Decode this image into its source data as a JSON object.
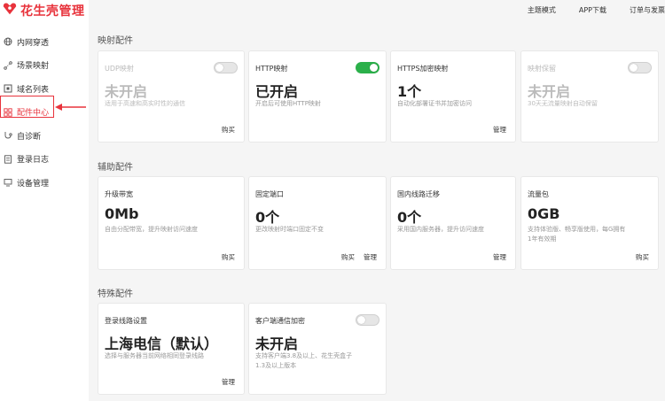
{
  "brand": {
    "name": "花生壳管理",
    "color": "#e8333c"
  },
  "topbar": {
    "links": [
      "主题模式",
      "APP下载",
      "订单与发票"
    ]
  },
  "sidebar": {
    "items": [
      {
        "label": "内网穿透",
        "icon": "globe-icon"
      },
      {
        "label": "场景映射",
        "icon": "route-icon"
      },
      {
        "label": "域名列表",
        "icon": "domain-icon"
      },
      {
        "label": "配件中心",
        "icon": "grid-icon",
        "active": true
      },
      {
        "label": "自诊断",
        "icon": "diagnose-icon"
      },
      {
        "label": "登录日志",
        "icon": "log-icon"
      },
      {
        "label": "设备管理",
        "icon": "device-icon"
      }
    ]
  },
  "sections": [
    {
      "title": "映射配件",
      "cards": [
        {
          "title": "UDP映射",
          "value": "未开启",
          "desc": "适用于高速和高实时性的通信",
          "toggle": "off",
          "disabled": true,
          "actions": [
            "购买"
          ]
        },
        {
          "title": "HTTP映射",
          "value": "已开启",
          "desc": "开启后可使用HTTP映射",
          "toggle": "on",
          "disabled": false,
          "actions": []
        },
        {
          "title": "HTTPS加密映射",
          "value": "1个",
          "desc": "自动化部署证书并加密访问",
          "toggle": null,
          "disabled": false,
          "actions": [
            "管理"
          ]
        },
        {
          "title": "映射保留",
          "value": "未开启",
          "desc": "30天无流量映射自动保留",
          "toggle": "off",
          "disabled": true,
          "actions": []
        }
      ]
    },
    {
      "title": "辅助配件",
      "cards": [
        {
          "title": "升级带宽",
          "value": "0Mb",
          "desc": "自由分配带宽，提升映射访问速度",
          "toggle": null,
          "disabled": false,
          "actions": [
            "购买"
          ]
        },
        {
          "title": "固定端口",
          "value": "0个",
          "desc": "更改映射时端口固定不变",
          "toggle": null,
          "disabled": false,
          "actions": [
            "购买",
            "管理"
          ]
        },
        {
          "title": "国内线路迁移",
          "value": "0个",
          "desc": "采用国内服务器，提升访问速度",
          "toggle": null,
          "disabled": false,
          "actions": [
            "管理"
          ]
        },
        {
          "title": "流量包",
          "value": "0GB",
          "desc": "支持体验版、畅享版使用，每G拥有\n1年有效期",
          "toggle": null,
          "disabled": false,
          "actions": [
            "购买"
          ]
        }
      ]
    },
    {
      "title": "特殊配件",
      "cards": [
        {
          "title": "登录线路设置",
          "value": "上海电信（默认）",
          "desc": "选择与服务器当前网络相同登录线路",
          "toggle": null,
          "disabled": false,
          "actions": [
            "管理"
          ]
        },
        {
          "title": "客户端通信加密",
          "value": "未开启",
          "desc": "支持客户端3.8及以上、花生壳盒子\n1.3及以上版本",
          "toggle": "off",
          "disabled": false,
          "actions": []
        }
      ]
    }
  ],
  "colors": {
    "accent": "#e8333c",
    "toggle_on": "#2bb04a"
  }
}
